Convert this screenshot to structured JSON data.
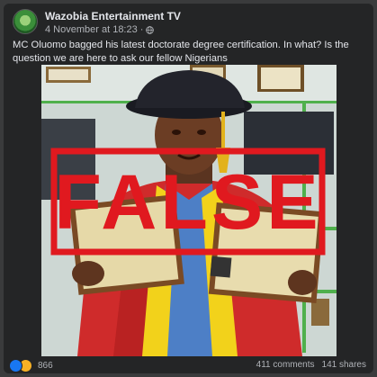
{
  "post": {
    "page_name": "Wazobia Entertainment TV",
    "timestamp": "4 November at 18:23",
    "separator": "·",
    "visibility_icon": "globe-icon",
    "caption": "MC Oluomo bagged his latest doctorate degree certification. In what? Is the question we are here to ask our fellow Nigerians"
  },
  "image": {
    "stamp_text": "FALSE",
    "stamp_color": "#e0191f",
    "gown_color": "#d42a2a",
    "stole_color": "#f2d21b"
  },
  "footer": {
    "reaction_icons": [
      "like-icon",
      "care-icon"
    ],
    "reaction_count": "866",
    "comments": "411 comments",
    "shares": "141 shares"
  }
}
